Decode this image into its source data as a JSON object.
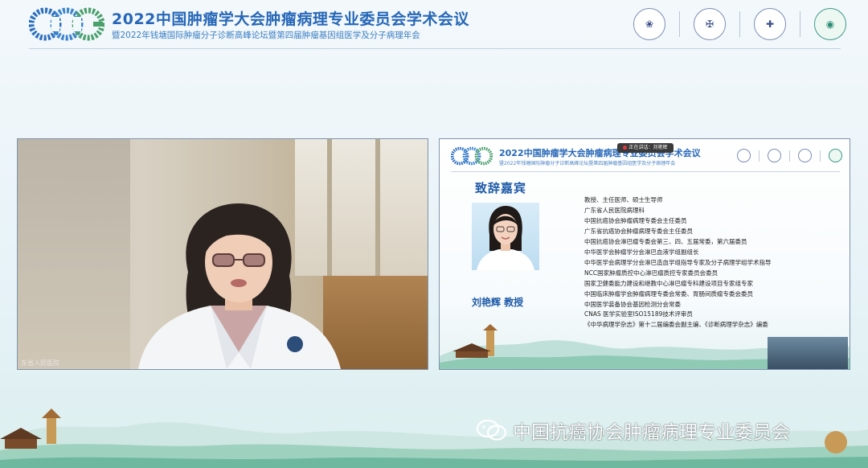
{
  "header": {
    "title": "2022中国肿瘤学大会肿瘤病理专业委员会学术会议",
    "subtitle": "暨2022年钱塘国际肿瘤分子诊断高峰论坛暨第四届肿瘤基因组医学及分子病理年会"
  },
  "video": {
    "caption": "东省人民医院"
  },
  "slide": {
    "title": "2022中国肿瘤学大会肿瘤病理专业委员会学术会议",
    "subtitle": "暨2022年钱塘国际肿瘤分子诊断高峰论坛暨第四届肿瘤基因组医学及分子病理年会",
    "notice": "正在讲话：刘艳辉",
    "section_heading": "致辞嘉宾",
    "guest_name": "刘艳辉 教授",
    "bio": [
      "教授、主任医师、硕士生导师",
      "广东省人民医院病理科",
      "中国抗癌协会肿瘤病理专委会主任委员",
      "广东省抗癌协会肿瘤病理专委会主任委员",
      "中国抗癌协会淋巴瘤专委会第三、四、五届常委，第六届委员",
      "中华医学会肿瘤学分会淋巴血液学组副组长",
      "中华医学会病理学分会淋巴造血学组指导专家及分子病理学组学术指导",
      "NCC国家肿瘤质控中心淋巴瘤质控专家委员会委员",
      "国家卫健委能力建设和继教中心淋巴瘤专科建设项目专家组专家",
      "中国临床肿瘤学会肿瘤病理专委会常委、胃肠间质瘤专委会委员",
      "中国医学装备协会基因检测分会常委",
      "CNAS 医学实验室ISO15189技术评审员",
      "《中华病理学杂志》第十二届编委会副主编、《诊断病理学杂志》编委"
    ]
  },
  "watermark": {
    "text": "中国抗癌协会肿瘤病理专业委员会",
    "icon": "wechat-icon"
  },
  "colors": {
    "brand_blue": "#2667b8",
    "accent_green": "#3c9a87"
  }
}
